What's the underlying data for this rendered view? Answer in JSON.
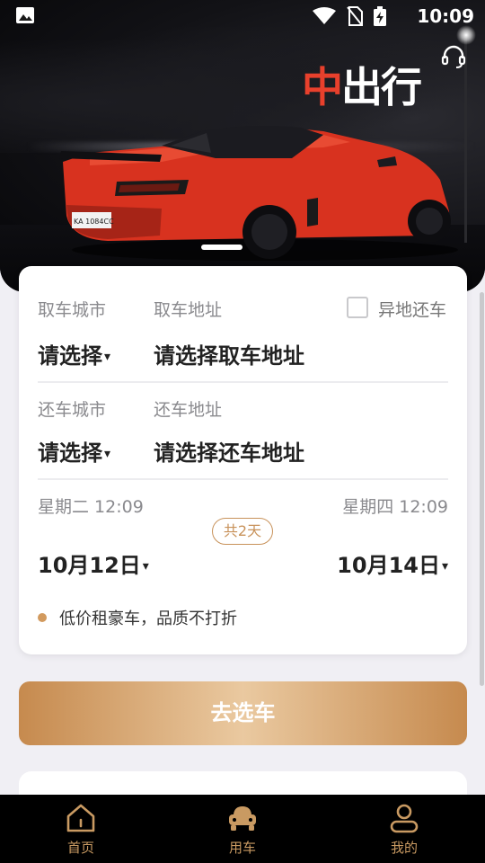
{
  "status_bar": {
    "time": "10:09",
    "icons": [
      "gallery-icon",
      "wifi-icon",
      "no-sim-icon",
      "battery-charging-icon"
    ]
  },
  "hero": {
    "brand_part1": "中",
    "brand_part2": "出行",
    "plate": "KA 1084CC",
    "support_icon": "headset-icon"
  },
  "pickup": {
    "city_label": "取车城市",
    "city_value": "请选择",
    "address_label": "取车地址",
    "address_value": "请选择取车地址",
    "different_return_label": "异地还车"
  },
  "return": {
    "city_label": "还车城市",
    "city_value": "请选择",
    "address_label": "还车地址",
    "address_value": "请选择还车地址"
  },
  "dates": {
    "start_weekday_time": "星期二 12:09",
    "end_weekday_time": "星期四 12:09",
    "start_date": "10月12日",
    "end_date": "10月14日",
    "duration": "共2天",
    "caret": "▾"
  },
  "slogan": "低价租豪车，品质不打折",
  "go_button": "去选车",
  "nav": {
    "items": [
      {
        "label": "首页",
        "icon": "home-icon"
      },
      {
        "label": "用车",
        "icon": "car-icon"
      },
      {
        "label": "我的",
        "icon": "user-icon"
      }
    ]
  },
  "colors": {
    "accent": "#c99a62",
    "brand_red": "#e8402c",
    "nav_bg": "#000000"
  }
}
